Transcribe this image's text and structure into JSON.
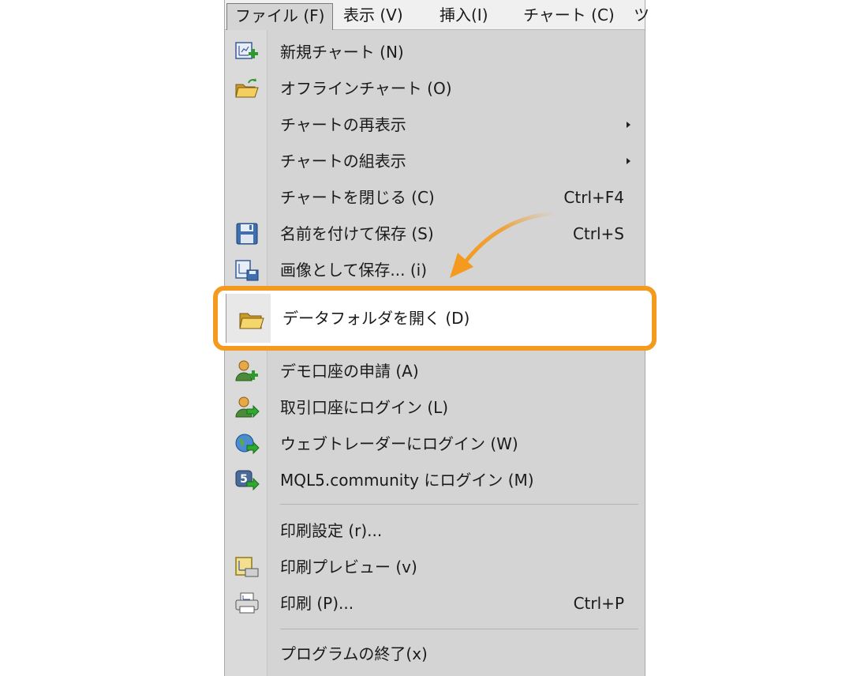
{
  "menubar": {
    "items": [
      {
        "label": "ファイル (F)"
      },
      {
        "label": "表示 (V)"
      },
      {
        "label": "挿入(I)"
      },
      {
        "label": "チャート (C)"
      },
      {
        "label": "ツ"
      }
    ]
  },
  "file_menu": {
    "new_chart": {
      "label": "新規チャート (N)",
      "icon": "new-chart-icon"
    },
    "offline_chart": {
      "label": "オフラインチャート (O)",
      "icon": "folder-open-icon"
    },
    "reopen_chart": {
      "label": "チャートの再表示",
      "icon": "submenu-arrow-icon"
    },
    "chart_set": {
      "label": "チャートの組表示",
      "icon": "submenu-arrow-icon"
    },
    "close_chart": {
      "label": "チャートを閉じる (C)",
      "shortcut": "Ctrl+F4"
    },
    "save_as": {
      "label": "名前を付けて保存 (S)",
      "shortcut": "Ctrl+S",
      "icon": "floppy-disk-icon"
    },
    "save_as_picture": {
      "label": "画像として保存... (i)",
      "icon": "save-picture-icon"
    },
    "open_data_folder": {
      "label": "データフォルダを開く (D)",
      "icon": "folder-icon"
    },
    "open_demo_account": {
      "label": "デモ口座の申請 (A)",
      "icon": "user-add-icon"
    },
    "login_trade_account": {
      "label": "取引口座にログイン (L)",
      "icon": "user-login-icon"
    },
    "login_web_trader": {
      "label": "ウェブトレーダーにログイン (W)",
      "icon": "globe-login-icon"
    },
    "login_mql5": {
      "label": "MQL5.community にログイン (M)",
      "icon": "mql5-login-icon"
    },
    "print_setup": {
      "label": "印刷設定 (r)..."
    },
    "print_preview": {
      "label": "印刷プレビュー (v)",
      "icon": "print-preview-icon"
    },
    "print": {
      "label": "印刷 (P)...",
      "shortcut": "Ctrl+P",
      "icon": "printer-icon"
    },
    "exit": {
      "label": "プログラムの終了(x)"
    }
  },
  "colors": {
    "highlight_border": "#f39a1f",
    "arrow": "#f39a1f",
    "menu_background": "#d4d4d4"
  }
}
